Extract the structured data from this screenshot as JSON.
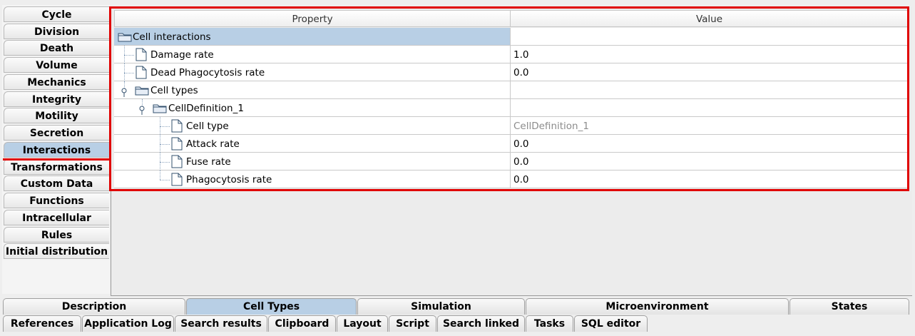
{
  "left_tabs": [
    "Cycle",
    "Division",
    "Death",
    "Volume",
    "Mechanics",
    "Integrity",
    "Motility",
    "Secretion",
    "Interactions",
    "Transformations",
    "Custom Data",
    "Functions",
    "Intracellular",
    "Rules",
    "Initial distribution"
  ],
  "left_active": "Interactions",
  "table": {
    "headers": {
      "property": "Property",
      "value": "Value"
    },
    "rows": [
      {
        "label": "Cell interactions",
        "value": "",
        "icon": "folder-icon",
        "selected": true
      },
      {
        "label": "Damage rate",
        "value": "1.0",
        "icon": "document-icon"
      },
      {
        "label": "Dead Phagocytosis rate",
        "value": "0.0",
        "icon": "document-icon"
      },
      {
        "label": "Cell types",
        "value": "",
        "icon": "folder-icon",
        "expand_icon": "expand-handle-icon"
      },
      {
        "label": "CellDefinition_1",
        "value": "",
        "icon": "folder-icon",
        "expand_icon": "expand-handle-icon"
      },
      {
        "label": "Cell type",
        "value": "CellDefinition_1",
        "icon": "document-icon",
        "value_disabled": true
      },
      {
        "label": "Attack rate",
        "value": "0.0",
        "icon": "document-icon"
      },
      {
        "label": "Fuse rate",
        "value": "0.0",
        "icon": "document-icon"
      },
      {
        "label": "Phagocytosis rate",
        "value": "0.0",
        "icon": "document-icon"
      }
    ]
  },
  "bottom_tabs_row1": [
    "Description",
    "Cell Types",
    "Simulation",
    "Microenvironment",
    "States"
  ],
  "bottom_active": "Cell Types",
  "bottom_tabs_row2": [
    "References",
    "Application Log",
    "Search results",
    "Clipboard",
    "Layout",
    "Script",
    "Search linked",
    "Tasks",
    "SQL editor"
  ],
  "colors": {
    "selection": "#b8cfe5",
    "highlight_outline": "#e00000"
  }
}
